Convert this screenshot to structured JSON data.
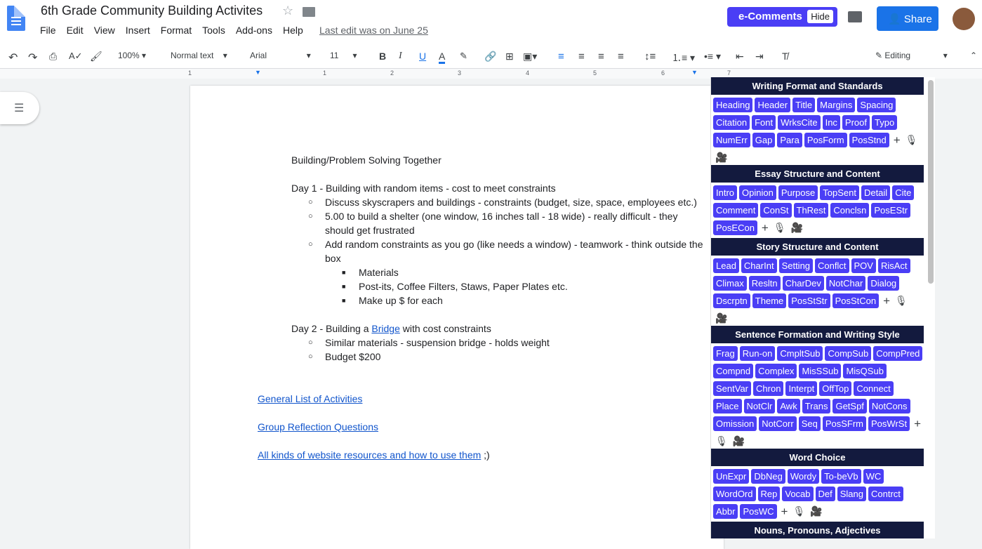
{
  "app": {
    "title": "6th Grade Community Building Activites",
    "last_edit": "Last edit was on June 25",
    "menu": [
      "File",
      "Edit",
      "View",
      "Insert",
      "Format",
      "Tools",
      "Add-ons",
      "Help"
    ],
    "ecomments": "e-Comments",
    "hide": "Hide",
    "share": "Share"
  },
  "toolbar": {
    "zoom": "100%",
    "style": "Normal text",
    "font": "Arial",
    "size": "11",
    "mode": "Editing"
  },
  "ruler": [
    "1",
    "1",
    "2",
    "3",
    "4",
    "5",
    "6",
    "7"
  ],
  "doc": {
    "lines": [
      {
        "lvl": "l0",
        "text": "Building/Problem Solving Together"
      },
      {
        "lvl": "blank",
        "text": ""
      },
      {
        "lvl": "l0",
        "text": "Day 1 - Building with random items - cost to meet constraints"
      },
      {
        "lvl": "l1",
        "text": "Discuss skyscrapers and buildings - constraints (budget, size, space, employees etc.)"
      },
      {
        "lvl": "l1",
        "text": "5.00 to build a shelter (one window, 16 inches tall - 18 wide) - really difficult - they should get frustrated"
      },
      {
        "lvl": "l1",
        "text": "Add random constraints as you go (like needs a window) - teamwork - think outside the box"
      },
      {
        "lvl": "l2",
        "text": "Materials"
      },
      {
        "lvl": "l2",
        "text": "Post-its, Coffee Filters, Staws, Paper Plates etc."
      },
      {
        "lvl": "l2",
        "text": "Make up $ for each"
      },
      {
        "lvl": "blank",
        "text": ""
      }
    ],
    "day2_pre": "Day 2 - Building a ",
    "day2_link": "Bridge",
    "day2_post": " with cost constraints",
    "day2_items": [
      "Similar materials - suspension bridge - holds weight",
      "Budget $200"
    ],
    "link1": "General List of Activities",
    "link2": "Group Reflection Questions",
    "link3": "All kinds of website resources and how to use them",
    "link3_suffix": " ;)"
  },
  "panel": {
    "sections": [
      {
        "title": "Writing Format and Standards",
        "buttons": [
          "Heading",
          "Header",
          "Title",
          "Margins",
          "Spacing",
          "Citation",
          "Font",
          "WrksCite",
          "Inc",
          "Proof",
          "Typo",
          "NumErr",
          "Gap",
          "Para",
          "PosForm",
          "PosStnd"
        ]
      },
      {
        "title": "Essay Structure and Content",
        "buttons": [
          "Intro",
          "Opinion",
          "Purpose",
          "TopSent",
          "Detail",
          "Cite",
          "Comment",
          "ConSt",
          "ThRest",
          "Conclsn",
          "PosEStr",
          "PosECon"
        ]
      },
      {
        "title": "Story Structure and Content",
        "buttons": [
          "Lead",
          "CharInt",
          "Setting",
          "Conflct",
          "POV",
          "RisAct",
          "Climax",
          "Resltn",
          "CharDev",
          "NotChar",
          "Dialog",
          "Dscrptn",
          "Theme",
          "PosStStr",
          "PosStCon"
        ]
      },
      {
        "title": "Sentence Formation and Writing Style",
        "buttons": [
          "Frag",
          "Run-on",
          "CmpltSub",
          "CompSub",
          "CompPred",
          "Compnd",
          "Complex",
          "MisSSub",
          "MisQSub",
          "SentVar",
          "Chron",
          "Interpt",
          "OffTop",
          "Connect",
          "Place",
          "NotClr",
          "Awk",
          "Trans",
          "GetSpf",
          "NotCons",
          "Omission",
          "NotCorr",
          "Seq",
          "PosSFrm",
          "PosWrSt"
        ]
      },
      {
        "title": "Word Choice",
        "buttons": [
          "UnExpr",
          "DbNeg",
          "Wordy",
          "To-beVb",
          "WC",
          "WordOrd",
          "Rep",
          "Vocab",
          "Def",
          "Slang",
          "Contrct",
          "Abbr",
          "PosWC"
        ]
      },
      {
        "title": "Nouns, Pronouns, Adjectives",
        "buttons": []
      }
    ]
  }
}
